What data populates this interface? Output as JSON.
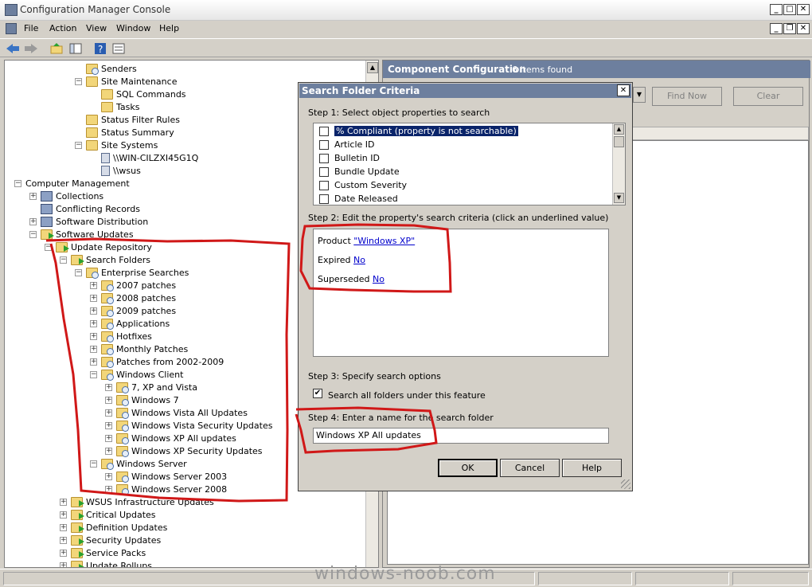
{
  "window": {
    "title": "Configuration Manager Console",
    "minimize": "_",
    "maximize": "□",
    "close": "✕"
  },
  "menu": [
    "File",
    "Action",
    "View",
    "Window",
    "Help"
  ],
  "tree": [
    {
      "label": "Senders",
      "depth": 5,
      "exp": "",
      "icon": "folder-sq"
    },
    {
      "label": "Site Maintenance",
      "depth": 5,
      "exp": "−",
      "icon": "folder"
    },
    {
      "label": "SQL Commands",
      "depth": 6,
      "exp": "",
      "icon": "folder"
    },
    {
      "label": "Tasks",
      "depth": 6,
      "exp": "",
      "icon": "folder"
    },
    {
      "label": "Status Filter Rules",
      "depth": 5,
      "exp": "",
      "icon": "folder"
    },
    {
      "label": "Status Summary",
      "depth": 5,
      "exp": "",
      "icon": "folder"
    },
    {
      "label": "Site Systems",
      "depth": 5,
      "exp": "−",
      "icon": "folder"
    },
    {
      "label": "\\\\WIN-CILZXI45G1Q",
      "depth": 6,
      "exp": "",
      "icon": "server"
    },
    {
      "label": "\\\\wsus",
      "depth": 6,
      "exp": "",
      "icon": "server"
    },
    {
      "label": "Computer Management",
      "depth": 1,
      "exp": "−",
      "icon": "none"
    },
    {
      "label": "Collections",
      "depth": 2,
      "exp": "+",
      "icon": "compu"
    },
    {
      "label": "Conflicting Records",
      "depth": 2,
      "exp": "",
      "icon": "compu"
    },
    {
      "label": "Software Distribution",
      "depth": 2,
      "exp": "+",
      "icon": "compu"
    },
    {
      "label": "Software Updates",
      "depth": 2,
      "exp": "−",
      "icon": "folder-ar"
    },
    {
      "label": "Update Repository",
      "depth": 3,
      "exp": "−",
      "icon": "folder-ar"
    },
    {
      "label": "Search Folders",
      "depth": 4,
      "exp": "−",
      "icon": "folder-ar"
    },
    {
      "label": "Enterprise Searches",
      "depth": 5,
      "exp": "−",
      "icon": "folder-sq"
    },
    {
      "label": "2007 patches",
      "depth": 6,
      "exp": "+",
      "icon": "folder-sq"
    },
    {
      "label": "2008 patches",
      "depth": 6,
      "exp": "+",
      "icon": "folder-sq"
    },
    {
      "label": "2009 patches",
      "depth": 6,
      "exp": "+",
      "icon": "folder-sq"
    },
    {
      "label": "Applications",
      "depth": 6,
      "exp": "+",
      "icon": "folder-sq"
    },
    {
      "label": "Hotfixes",
      "depth": 6,
      "exp": "+",
      "icon": "folder-sq"
    },
    {
      "label": "Monthly Patches",
      "depth": 6,
      "exp": "+",
      "icon": "folder-sq"
    },
    {
      "label": "Patches from 2002-2009",
      "depth": 6,
      "exp": "+",
      "icon": "folder-sq"
    },
    {
      "label": "Windows Client",
      "depth": 6,
      "exp": "−",
      "icon": "folder-sq"
    },
    {
      "label": "7, XP and Vista",
      "depth": 7,
      "exp": "+",
      "icon": "folder-sq"
    },
    {
      "label": "Windows 7",
      "depth": 7,
      "exp": "+",
      "icon": "folder-sq"
    },
    {
      "label": "Windows Vista All Updates",
      "depth": 7,
      "exp": "+",
      "icon": "folder-sq"
    },
    {
      "label": "Windows Vista Security Updates",
      "depth": 7,
      "exp": "+",
      "icon": "folder-sq"
    },
    {
      "label": "Windows XP All updates",
      "depth": 7,
      "exp": "+",
      "icon": "folder-sq"
    },
    {
      "label": "Windows XP Security Updates",
      "depth": 7,
      "exp": "+",
      "icon": "folder-sq"
    },
    {
      "label": "Windows Server",
      "depth": 6,
      "exp": "−",
      "icon": "folder-sq"
    },
    {
      "label": "Windows Server 2003",
      "depth": 7,
      "exp": "+",
      "icon": "folder-sq"
    },
    {
      "label": "Windows Server 2008",
      "depth": 7,
      "exp": "+",
      "icon": "folder-sq"
    },
    {
      "label": "WSUS Infrastructure Updates",
      "depth": 4,
      "exp": "+",
      "icon": "folder-ar"
    },
    {
      "label": "Critical Updates",
      "depth": 4,
      "exp": "+",
      "icon": "folder-ar"
    },
    {
      "label": "Definition Updates",
      "depth": 4,
      "exp": "+",
      "icon": "folder-ar"
    },
    {
      "label": "Security Updates",
      "depth": 4,
      "exp": "+",
      "icon": "folder-ar"
    },
    {
      "label": "Service Packs",
      "depth": 4,
      "exp": "+",
      "icon": "folder-ar"
    },
    {
      "label": "Update Rollups",
      "depth": 4,
      "exp": "+",
      "icon": "folder-ar"
    }
  ],
  "right": {
    "header": "Component Configuration",
    "count": "6 items found",
    "find_now": "Find Now",
    "clear": "Clear"
  },
  "dialog": {
    "title": "Search Folder Criteria",
    "step1": "Step 1: Select object properties to search",
    "properties": [
      {
        "label": "% Compliant (property is not searchable)",
        "checked": false,
        "selected": true
      },
      {
        "label": "Article ID",
        "checked": false,
        "selected": false
      },
      {
        "label": "Bulletin ID",
        "checked": false,
        "selected": false
      },
      {
        "label": "Bundle Update",
        "checked": false,
        "selected": false
      },
      {
        "label": "Custom Severity",
        "checked": false,
        "selected": false
      },
      {
        "label": "Date Released",
        "checked": false,
        "selected": false
      }
    ],
    "step2": "Step 2: Edit the property's search criteria (click an underlined value)",
    "criteria": [
      {
        "name": "Product",
        "value": "\"Windows XP\""
      },
      {
        "name": "Expired",
        "value": "No"
      },
      {
        "name": "Superseded",
        "value": "No"
      }
    ],
    "step3": "Step 3: Specify search options",
    "search_all": "Search all folders under this feature",
    "search_all_checked": "✔",
    "step4": "Step 4: Enter a name for the search folder",
    "name_value": "Windows XP All updates",
    "ok": "OK",
    "cancel": "Cancel",
    "help": "Help"
  },
  "watermark": "windows-noob.com"
}
